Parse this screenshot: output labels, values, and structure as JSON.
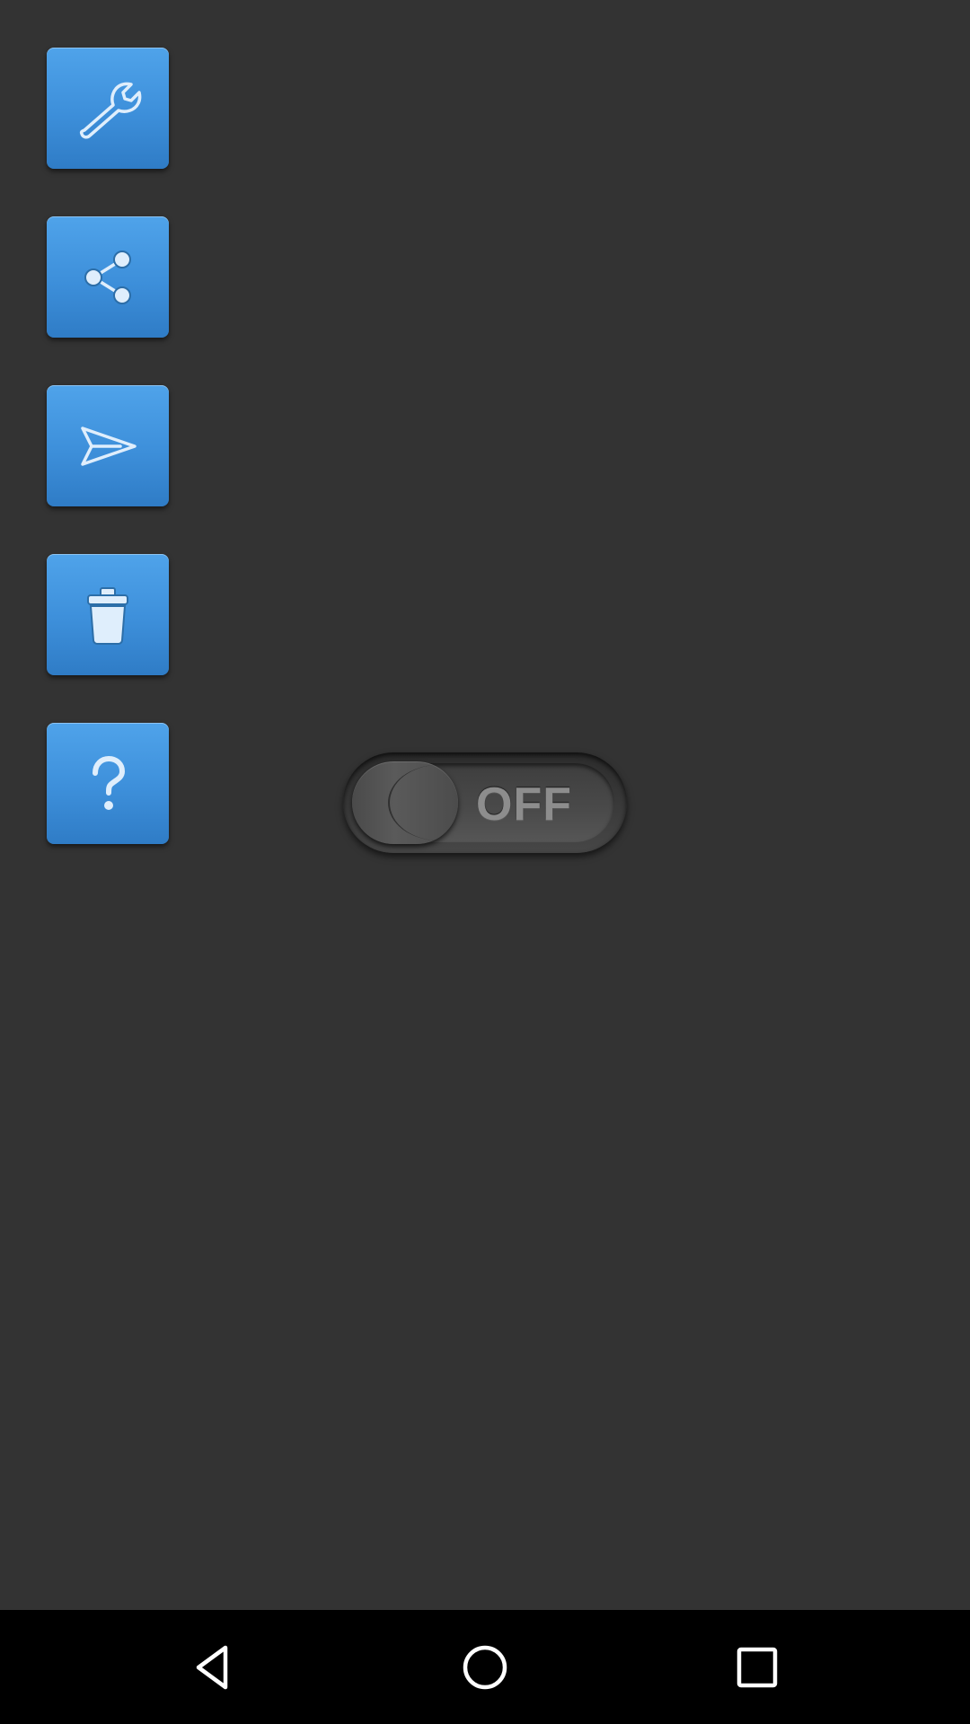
{
  "sidebar": {
    "buttons": [
      {
        "icon": "wrench-icon"
      },
      {
        "icon": "share-icon"
      },
      {
        "icon": "send-icon"
      },
      {
        "icon": "trash-icon"
      },
      {
        "icon": "help-icon",
        "glyph": "?"
      }
    ]
  },
  "toggle": {
    "label": "OFF",
    "state": "off"
  },
  "nav": {
    "back": "back-icon",
    "home": "home-icon",
    "recents": "recents-icon"
  },
  "colors": {
    "background": "#333333",
    "button_blue": "#3d8fda",
    "nav_bar": "#000000"
  }
}
